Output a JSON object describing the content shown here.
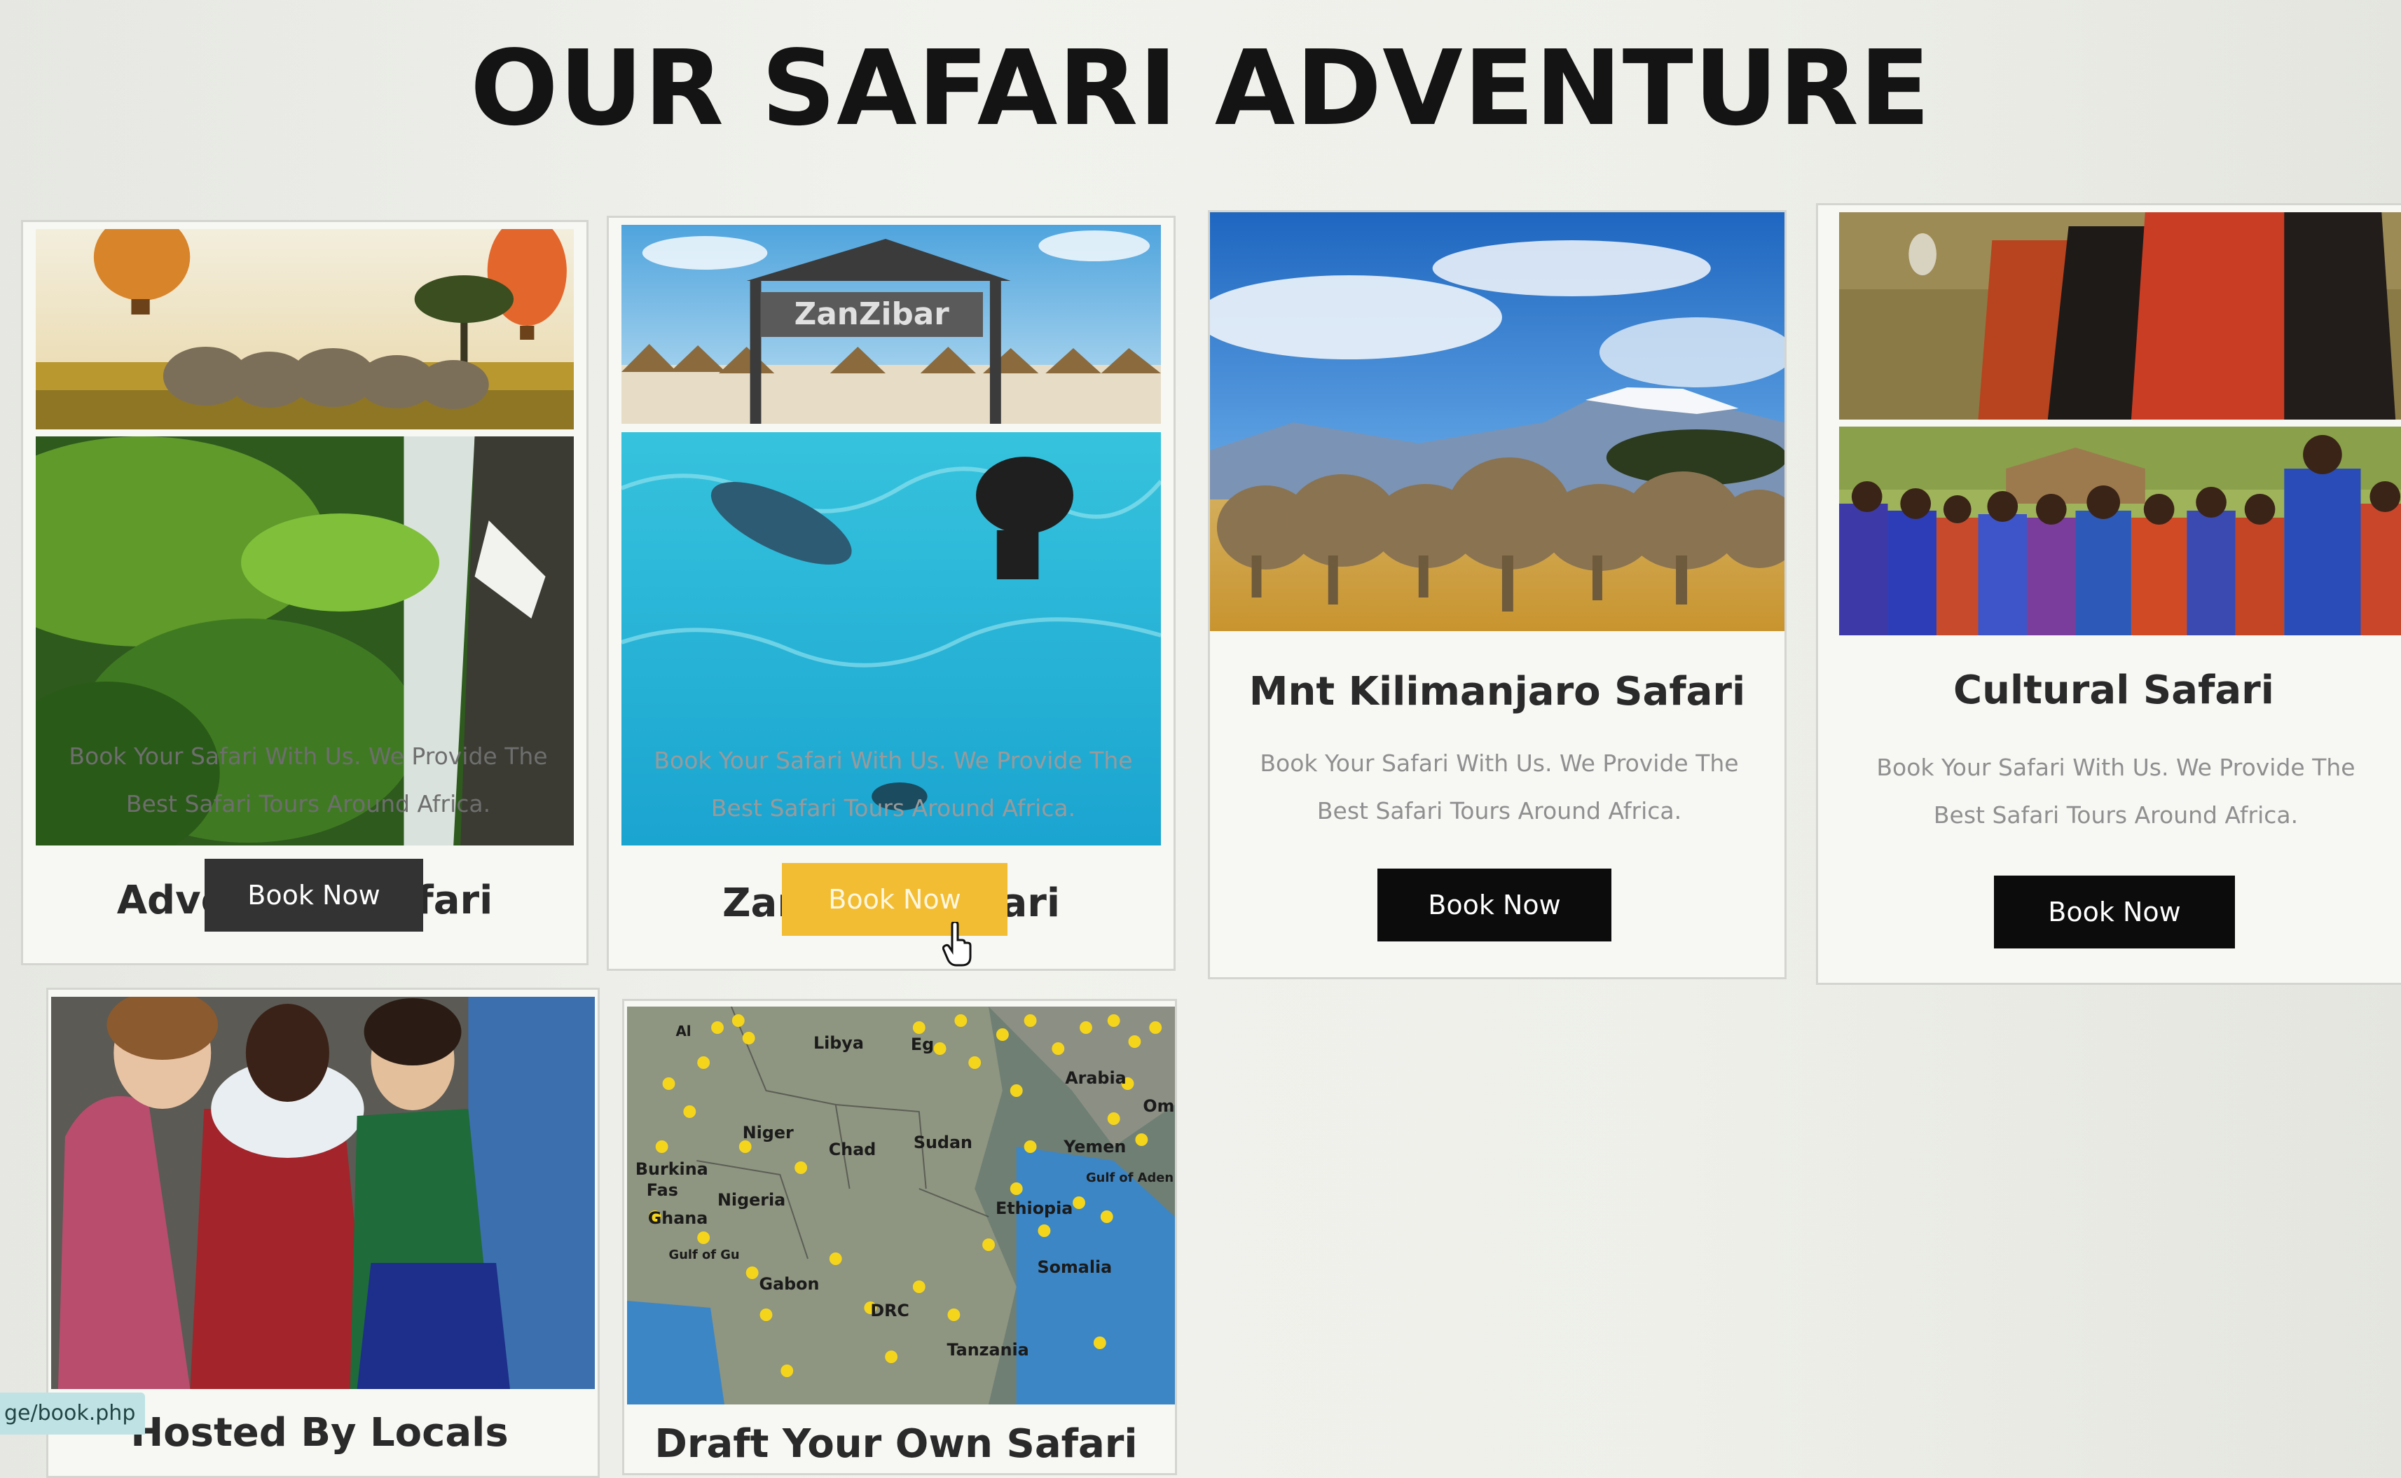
{
  "page": {
    "title": "OUR SAFARI ADVENTURE"
  },
  "cards": [
    {
      "title": "Adventure Safari",
      "desc_line1": "Book Your Safari With Us. We Provide The",
      "desc_line2": "Best Safari Tours Around Africa.",
      "button": "Book Now",
      "button_bg": "#333333",
      "button_fg": "#ffffff"
    },
    {
      "title": "Zanzibar Safari",
      "desc_line1": "Book Your Safari With Us. We Provide The",
      "desc_line2": "Best Safari Tours Around Africa.",
      "button": "Book Now",
      "button_bg": "#f2bd32",
      "button_fg": "#fff7e0",
      "hovered": true
    },
    {
      "title": "Mnt Kilimanjaro Safari",
      "desc_line1": "Book Your Safari With Us. We Provide The",
      "desc_line2": "Best Safari Tours Around Africa.",
      "button": "Book Now",
      "button_bg": "#0c0c0c",
      "button_fg": "#ffffff"
    },
    {
      "title": "Cultural Safari",
      "desc_line1": "Book Your Safari With Us. We Provide The",
      "desc_line2": "Best Safari Tours Around Africa.",
      "button": "Book Now",
      "button_bg": "#0c0c0c",
      "button_fg": "#ffffff"
    },
    {
      "title": "Hosted By Locals"
    },
    {
      "title": "Draft Your Own Safari"
    }
  ],
  "images": {
    "zanzibar_sign": "ZanZibar",
    "map_labels": [
      "Libya",
      "Eg",
      "Arabia",
      "Om",
      "Niger",
      "Chad",
      "Sudan",
      "Yemen",
      "Burkina",
      "Fas",
      "Nigeria",
      "Ghana",
      "Ethiopia",
      "Gulf of Aden",
      "Somalia",
      "Gabon",
      "DRC",
      "Tanzania",
      "Gulf of Gu",
      "Al"
    ]
  },
  "status_bar": {
    "url": "ge/book.php"
  },
  "colors": {
    "accent": "#f2bd32",
    "dark_button": "#0c0c0c",
    "heading": "#141414"
  }
}
